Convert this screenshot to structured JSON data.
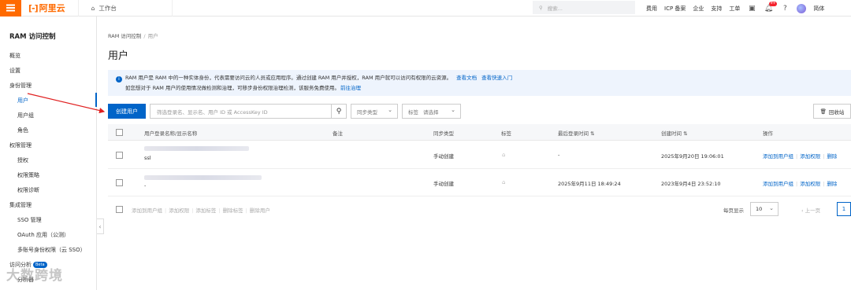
{
  "topbar": {
    "logo_mark": "[-]",
    "logo_text": "阿里云",
    "workbench_label": "工作台",
    "search_placeholder": "搜索...",
    "links": [
      "费用",
      "ICP 备案",
      "企业",
      "支持",
      "工单"
    ],
    "notification_count": "9+",
    "language": "简体"
  },
  "sidebar": {
    "title": "RAM 访问控制",
    "items": [
      {
        "label": "概览"
      },
      {
        "label": "设置"
      },
      {
        "label": "身份管理"
      },
      {
        "label": "用户"
      },
      {
        "label": "用户组"
      },
      {
        "label": "角色"
      },
      {
        "label": "权限管理"
      },
      {
        "label": "授权"
      },
      {
        "label": "权限策略"
      },
      {
        "label": "权限诊断"
      },
      {
        "label": "集成管理"
      },
      {
        "label": "SSO 管理"
      },
      {
        "label": "OAuth 应用（公测）"
      },
      {
        "label": "多账号身份权限（云 SSO）"
      },
      {
        "label": "访问分析"
      },
      {
        "label": "分析器"
      }
    ],
    "beta_badge": "Beta"
  },
  "breadcrumb": {
    "root": "RAM 访问控制",
    "sep": "/",
    "current": "用户"
  },
  "page_title": "用户",
  "notice": {
    "line1": "RAM 用户是 RAM 中的一种实体身份，代表需要访问云的人员或应用程序。通过创建 RAM 用户并授权，RAM 用户就可以访问有权限的云资源。",
    "link1": "查看文档",
    "link2": "查看快速入门",
    "line2": "如您想对于 RAM 用户的使用情况做检测和治理，可移步身份权限治理检测，该服务免费使用。",
    "link3": "前往治理"
  },
  "toolbar": {
    "create_label": "创建用户",
    "search_placeholder": "筛选登录名、显示名、用户 ID 或 AccessKey ID",
    "sync_type": "同步类型",
    "tag_label": "标签",
    "tag_placeholder": "请选择",
    "recycle_label": "回收站"
  },
  "table": {
    "headers": [
      "用户登录名称/显示名称",
      "备注",
      "同步类型",
      "标签",
      "最后登录时间",
      "创建时间",
      "操作"
    ],
    "rows": [
      {
        "display_name": "ssl",
        "sync": "手动创建",
        "last_login": "-",
        "created": "2025年9月20日 19:06:01"
      },
      {
        "display_name": "-",
        "sync": "手动创建",
        "last_login": "2025年9月11日 18:49:24",
        "created": "2023年9月4日 23:52:10"
      }
    ],
    "row_actions": [
      "添加到用户组",
      "添加权限",
      "删除"
    ]
  },
  "footer": {
    "bulk_actions": [
      "添加到用户组",
      "添加权限",
      "添加标签",
      "删除标签",
      "删除用户"
    ],
    "page_size_label": "每页显示",
    "page_size": "10",
    "prev_label": "上一页",
    "current_page": "1"
  },
  "watermark": "大数跨境"
}
